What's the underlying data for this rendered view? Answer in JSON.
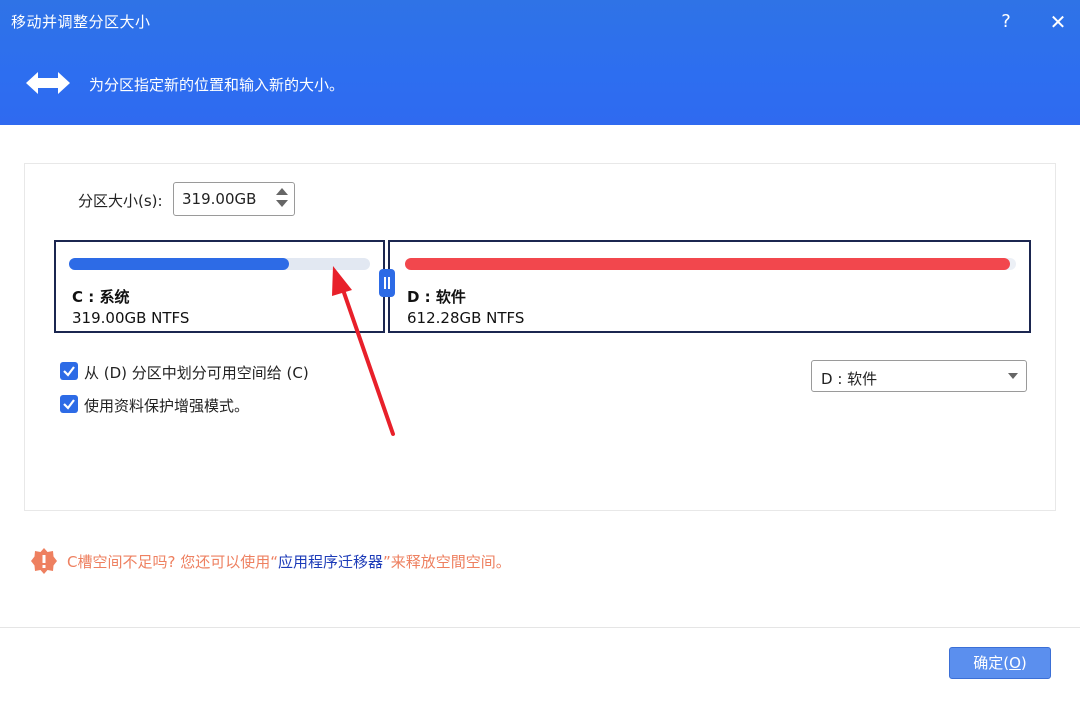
{
  "window": {
    "title": "移动并调整分区大小",
    "help_label": "?",
    "close_label": "✕"
  },
  "header": {
    "subtitle": "为分区指定新的位置和输入新的大小。",
    "icon": "double-arrow-icon"
  },
  "size": {
    "label": "分区大小(s):",
    "value": "319.00GB"
  },
  "partitions": [
    {
      "name": "C : 系统",
      "info": "319.00GB NTFS",
      "used_fraction": 0.73,
      "color": "#2d6be6"
    },
    {
      "name": "D : 软件",
      "info": "612.28GB NTFS",
      "used_fraction": 0.99,
      "color": "#f2474d"
    }
  ],
  "options": {
    "allocate_label": "从 (D) 分区中划分可用空间给 (C)",
    "allocate_checked": true,
    "safe_mode_label": "使用资料保护增强模式。",
    "safe_mode_checked": true
  },
  "source_select": {
    "value": "D : 软件"
  },
  "tip": {
    "icon": "warning-gear-icon",
    "prefix": "C槽空间不足吗? 您还可以使用“",
    "link": "应用程序迁移器",
    "suffix": "”来释放空間空间。"
  },
  "footer": {
    "ok_label": "确定(",
    "ok_key": "O",
    "ok_close": ")"
  },
  "colors": {
    "accent": "#2d6be6",
    "header": "#2f6ef0",
    "danger": "#f2474d",
    "annotation_arrow": "#e8202a"
  }
}
